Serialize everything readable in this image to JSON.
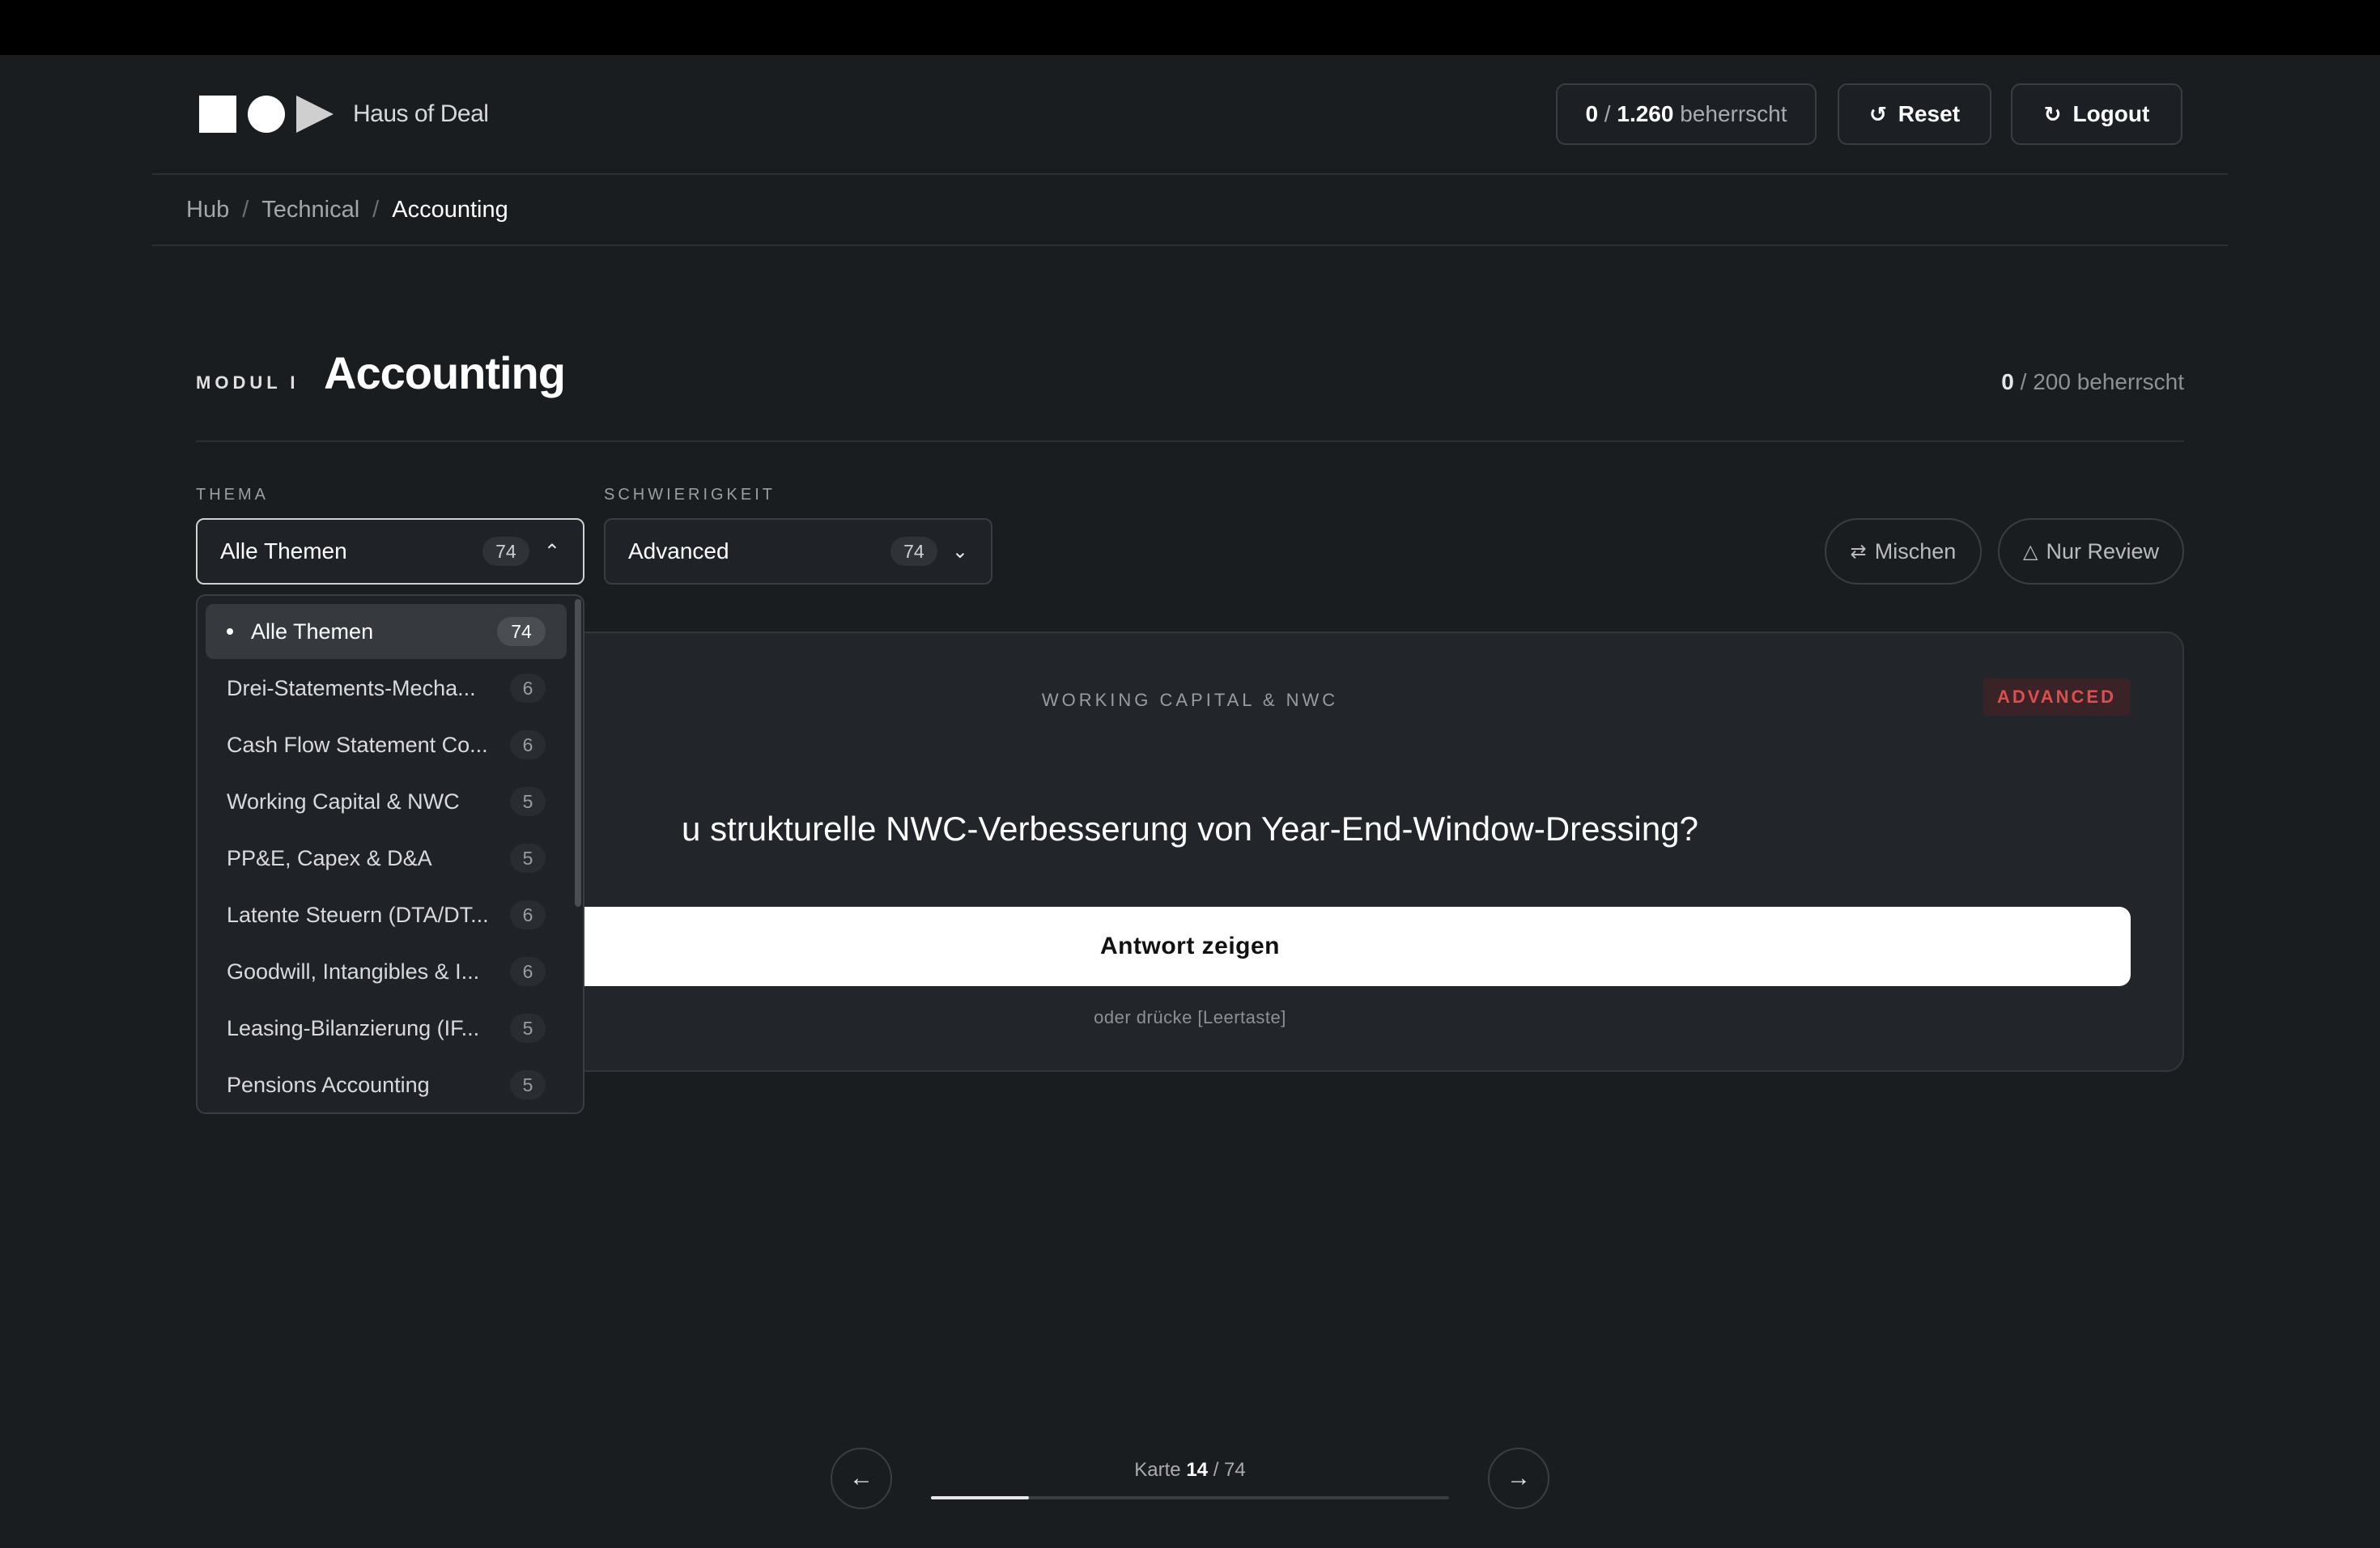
{
  "brand": "Haus of Deal",
  "header": {
    "mastered_count": "0",
    "mastered_total": "1.260",
    "mastered_suffix": "beherrscht",
    "reset_label": "Reset",
    "logout_label": "Logout"
  },
  "breadcrumb": [
    {
      "label": "Hub"
    },
    {
      "label": "Technical"
    },
    {
      "label": "Accounting"
    }
  ],
  "breadcrumb_sep": "/",
  "module": {
    "label": "MODUL I",
    "title": "Accounting",
    "mastered_count": "0",
    "mastered_rest": "/ 200 beherrscht"
  },
  "filters": {
    "thema_label": "THEMA",
    "thema_value": "Alle Themen",
    "thema_count": "74",
    "schwierigkeit_label": "SCHWIERIGKEIT",
    "schwierigkeit_value": "Advanced",
    "schwierigkeit_count": "74",
    "mischen_label": "Mischen",
    "review_label": "Nur Review"
  },
  "dropdown": {
    "items": [
      {
        "label": "Alle Themen",
        "count": "74",
        "active": true
      },
      {
        "label": "Drei-Statements-Mecha...",
        "count": "6"
      },
      {
        "label": "Cash Flow Statement Co...",
        "count": "6"
      },
      {
        "label": "Working Capital & NWC",
        "count": "5"
      },
      {
        "label": "PP&E, Capex & D&A",
        "count": "5"
      },
      {
        "label": "Latente Steuern (DTA/DT...",
        "count": "6"
      },
      {
        "label": "Goodwill, Intangibles & I...",
        "count": "6"
      },
      {
        "label": "Leasing-Bilanzierung (IF...",
        "count": "5"
      },
      {
        "label": "Pensions Accounting",
        "count": "5"
      }
    ]
  },
  "card": {
    "topic": "WORKING CAPITAL & NWC",
    "level": "ADVANCED",
    "question_visible": "u strukturelle NWC-Verbesserung von Year-End-Window-Dressing?",
    "reveal_label": "Antwort zeigen",
    "hint": "oder drücke [Leertaste]"
  },
  "footer": {
    "karte_prefix": "Karte",
    "current": "14",
    "total_text": "/ 74",
    "progress_fraction": 0.189
  },
  "icons": {
    "reset": "reset-icon",
    "logout": "logout-icon",
    "shuffle": "shuffle-icon",
    "review": "warning-icon",
    "prev": "arrow-left-icon",
    "next": "arrow-right-icon"
  }
}
